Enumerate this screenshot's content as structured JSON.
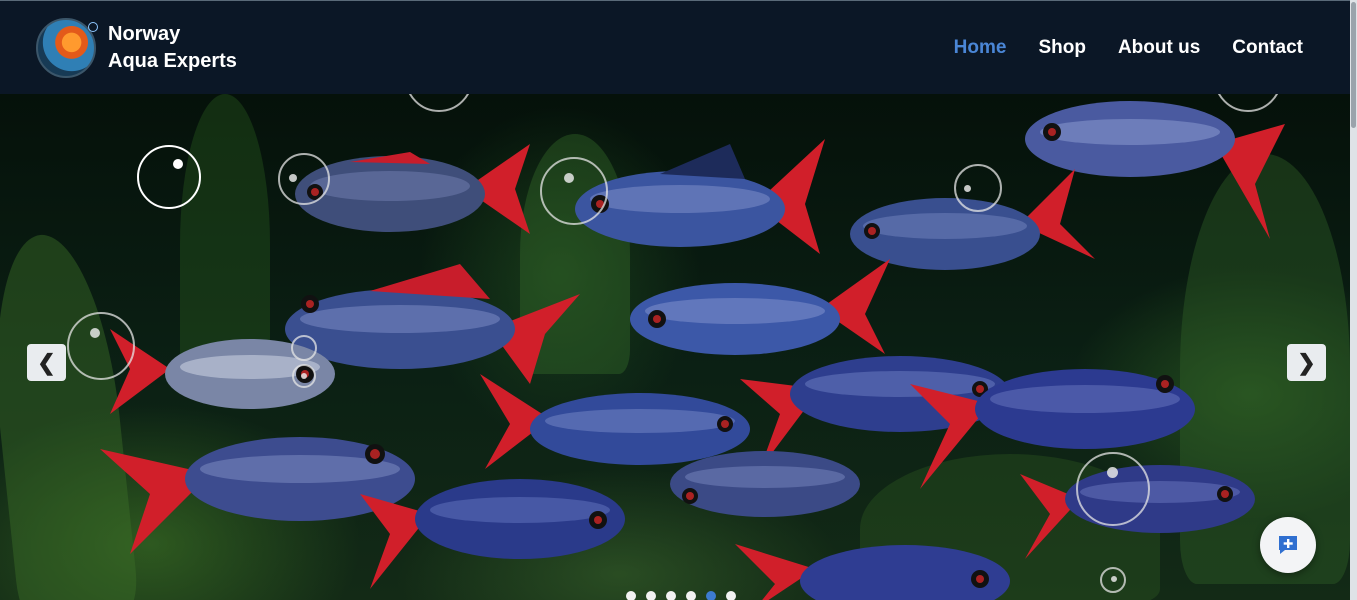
{
  "brand": {
    "line1": "Norway",
    "line2": "Aqua Experts",
    "logo_icon": "aquarium-fish-logo-icon"
  },
  "nav": {
    "items": [
      {
        "label": "Home",
        "active": true
      },
      {
        "label": "Shop",
        "active": false
      },
      {
        "label": "About us",
        "active": false
      },
      {
        "label": "Contact",
        "active": false
      }
    ]
  },
  "carousel": {
    "prev_label": "❮",
    "next_label": "❯",
    "slide_count": 6,
    "active_slide": 5,
    "image_subject": "school of blue and red tetra fish in planted aquarium"
  },
  "chat_button": {
    "icon": "chat-plus-icon"
  },
  "colors": {
    "header_bg": "#0b1726",
    "nav_active": "#4a86d6",
    "nav_text": "#ffffff"
  }
}
